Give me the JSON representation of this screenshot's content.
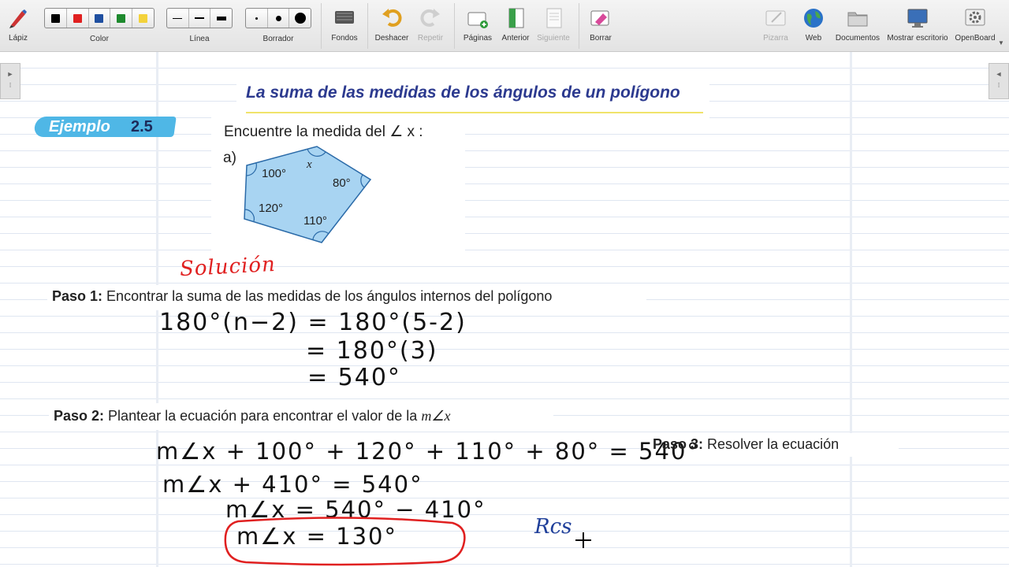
{
  "toolbar": {
    "pen": "Lápiz",
    "color": "Color",
    "line": "Línea",
    "eraser": "Borrador",
    "backgrounds": "Fondos",
    "undo": "Deshacer",
    "redo": "Repetir",
    "pages": "Páginas",
    "previous": "Anterior",
    "next": "Siguiente",
    "clear": "Borrar",
    "board": "Pizarra",
    "web": "Web",
    "documents": "Documentos",
    "show_desktop": "Mostrar escritorio",
    "openboard": "OpenBoard",
    "colors": [
      "#000000",
      "#e02020",
      "#1f4fa0",
      "#1e8a2e",
      "#f3d23b"
    ]
  },
  "page": {
    "title": "La suma de las medidas de los ángulos de un polígono",
    "example_label": "Ejemplo",
    "example_number": "2.5",
    "prompt": "Encuentre la medida del ∠ x :",
    "part": "a)",
    "polygon_angles": [
      "100°",
      "x",
      "80°",
      "120°",
      "110°"
    ],
    "handwritten_solution": "Solución",
    "step1": {
      "label": "Paso 1:",
      "text": "Encontrar la suma de las medidas de los ángulos internos del polígono"
    },
    "step1_work": [
      "180°(n−2)  =  180°(5-2)",
      "=  180°(3)",
      "=  540°"
    ],
    "step2": {
      "label": "Paso 2:",
      "text": "Plantear la ecuación para encontrar el valor de la",
      "math": "m∠x"
    },
    "step2_work": [
      "m∠x + 100° + 120° + 110° + 80°  =  540°",
      "m∠x  + 410°  = 540°",
      "m∠x   =  540° − 410°",
      "m∠x  =  130°"
    ],
    "step3": {
      "label": "Paso 3:",
      "text": "Resolver la ecuación"
    },
    "handwritten_note": "Rcs"
  }
}
